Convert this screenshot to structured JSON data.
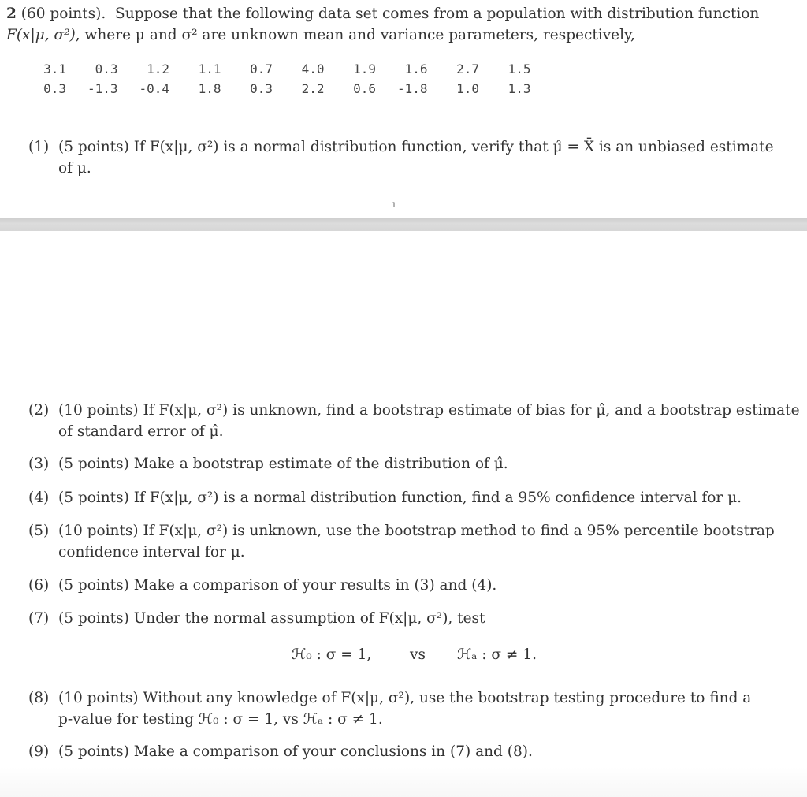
{
  "problem": {
    "number": "2",
    "points": "(60 points).",
    "intro_line1": "Suppose that the following data set comes from a population with distribution function",
    "intro_line2_math": "F(x|μ, σ²)",
    "intro_line2_text": ", where μ and σ² are unknown mean and variance parameters, respectively,"
  },
  "data_set": {
    "rows": [
      [
        "3.1",
        "0.3",
        "1.2",
        "1.1",
        "0.7",
        "4.0",
        "1.9",
        "1.6",
        "2.7",
        "1.5"
      ],
      [
        "0.3",
        "-1.3",
        "-0.4",
        "1.8",
        "0.3",
        "2.2",
        "0.6",
        "-1.8",
        "1.0",
        "1.3"
      ]
    ]
  },
  "page_number": "1",
  "questions": [
    {
      "label": "(1)",
      "line1": "(5 points) If F(x|μ, σ²) is a normal distribution function, verify that μ̂ = X̄ is an unbiased estimate",
      "line2": "of μ."
    },
    {
      "label": "(2)",
      "line1": "(10 points) If F(x|μ, σ²) is unknown, find a bootstrap estimate of bias for μ̂, and a bootstrap estimate",
      "line2": "of standard error of μ̂."
    },
    {
      "label": "(3)",
      "line1": "(5 points) Make a bootstrap estimate of the distribution of μ̂."
    },
    {
      "label": "(4)",
      "line1": "(5 points) If F(x|μ, σ²) is a normal distribution function, find a 95% confidence interval for μ."
    },
    {
      "label": "(5)",
      "line1": "(10 points) If F(x|μ, σ²) is unknown, use the bootstrap method to find a 95% percentile bootstrap",
      "line2": "confidence interval for μ."
    },
    {
      "label": "(6)",
      "line1": "(5 points) Make a comparison of your results in (3) and (4)."
    },
    {
      "label": "(7)",
      "line1": "(5 points) Under the normal assumption of F(x|μ, σ²), test"
    },
    {
      "label": "(8)",
      "line1": "(10 points) Without any knowledge of F(x|μ, σ²), use the bootstrap testing procedure to find a",
      "line2": "p-value for testing ℋ₀ : σ = 1, vs ℋₐ : σ ≠ 1."
    },
    {
      "label": "(9)",
      "line1": "(5 points) Make a comparison of your conclusions in (7) and (8)."
    }
  ],
  "hypothesis": {
    "null": "ℋ₀ : σ = 1,",
    "vs": "vs",
    "alt": "ℋₐ : σ ≠ 1."
  }
}
